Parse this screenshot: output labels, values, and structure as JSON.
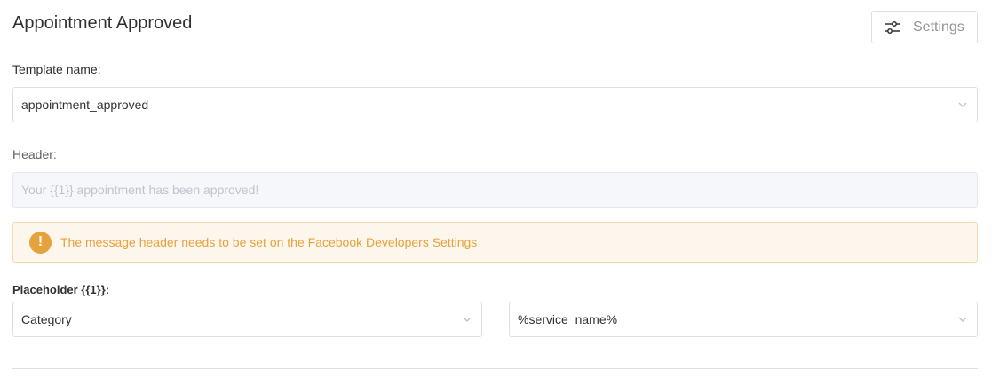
{
  "page": {
    "title": "Appointment Approved",
    "settings_label": "Settings"
  },
  "template_name": {
    "label": "Template name:",
    "value": "appointment_approved"
  },
  "header": {
    "label": "Header:",
    "placeholder": "Your {{1}} appointment has been approved!"
  },
  "alert": {
    "icon": "!",
    "message": "The message header needs to be set on the Facebook Developers Settings"
  },
  "placeholder": {
    "label": "Placeholder {{1}}:",
    "type_value": "Category",
    "field_value": "%service_name%"
  },
  "colors": {
    "warning": "#e6a23c",
    "warning_bg": "#fdf6ec",
    "border": "#dcdfe6"
  },
  "icons": {
    "settings": "sliders-icon",
    "dropdown": "chevron-down-icon",
    "alert": "exclamation-circle-icon"
  }
}
